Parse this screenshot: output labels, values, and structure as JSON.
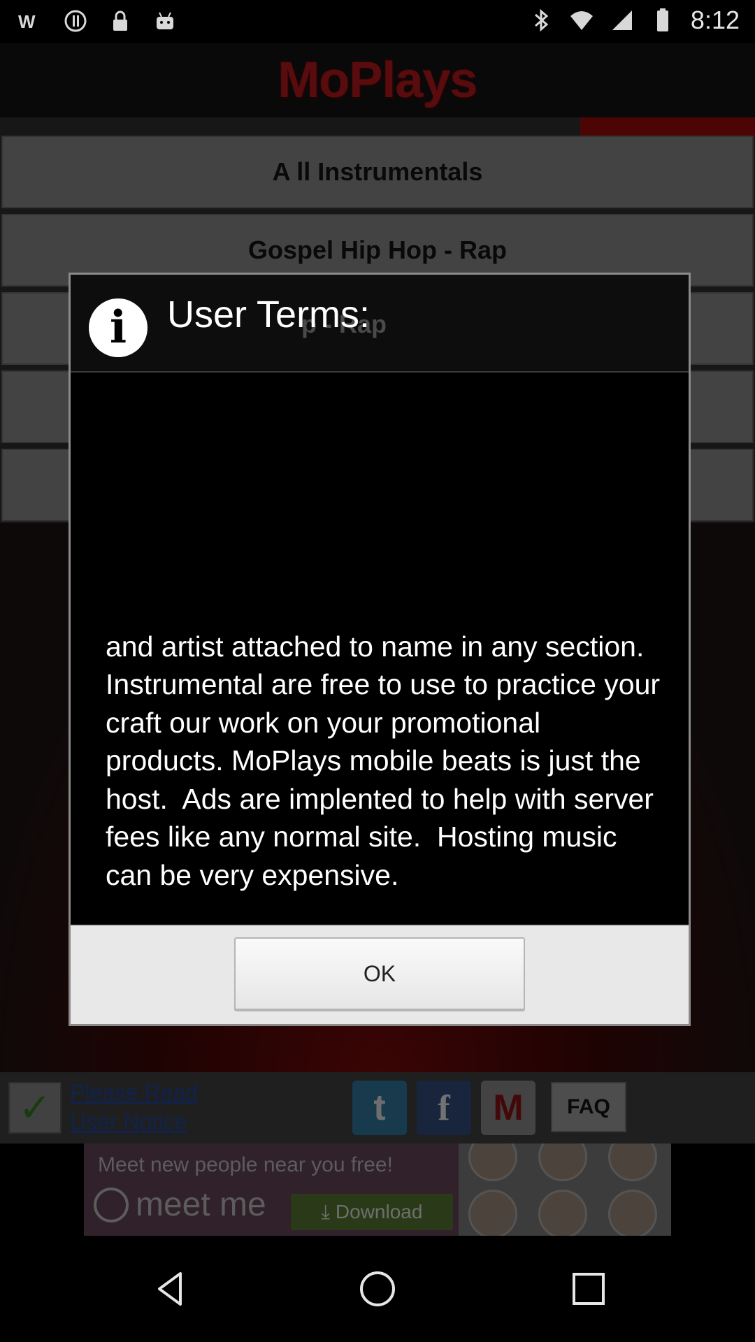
{
  "status_bar": {
    "time": "8:12",
    "icons": [
      "wf-icon",
      "blocked-icon",
      "lock-icon",
      "android-icon",
      "bluetooth-icon",
      "wifi-icon",
      "signal-icon",
      "battery-icon"
    ]
  },
  "app": {
    "logo_text": "MoPlays"
  },
  "background_list": {
    "items": [
      "A ll Instrumentals",
      "Gospel Hip Hop - Rap",
      "",
      "",
      ""
    ]
  },
  "dialog": {
    "title": "User Terms:",
    "title_bg_text": "p - Rap",
    "message": "and artist attached to name in any section. Instrumental are free to use to practice your craft our work on your promotional products. MoPlays mobile beats is just the host.  Ads are implented to help with server fees like any normal site.  Hosting music can be very expensive.",
    "ok_label": "OK"
  },
  "bottom_bar": {
    "notice_line1": "Please Read",
    "notice_line2": "User Notice",
    "twitter_glyph": "t",
    "facebook_glyph": "f",
    "moplays_glyph": "M",
    "faq_label": "FAQ"
  },
  "ad": {
    "headline": "Meet new people near you free!",
    "brand": "meet me",
    "download_label": "Download"
  },
  "colors": {
    "logo": "#a3161a",
    "link": "#1e3f8c",
    "ad_background": "#5a3d4d",
    "download_button": "#4d6a2c"
  }
}
